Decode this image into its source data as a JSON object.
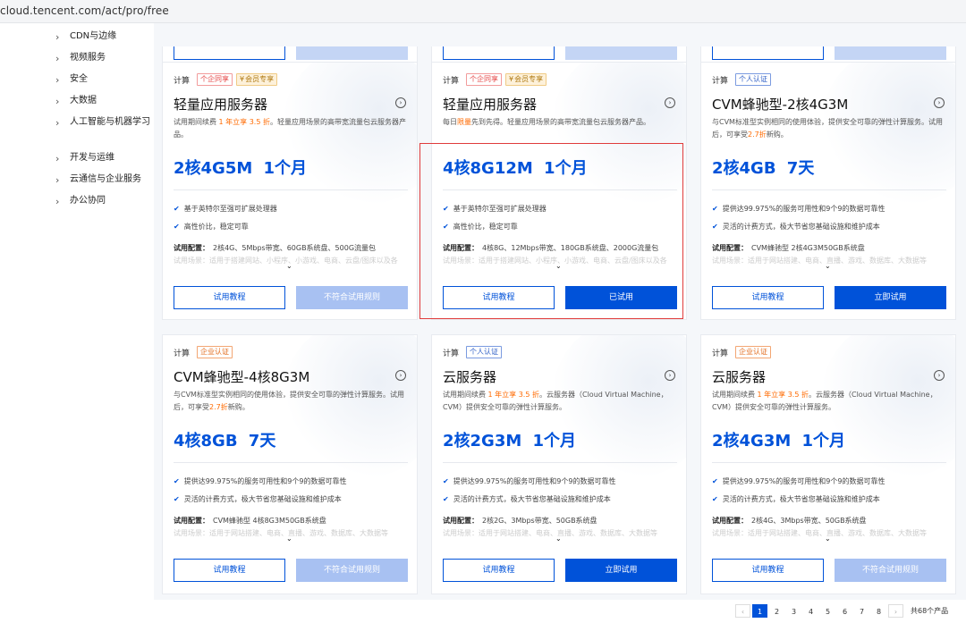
{
  "url": "cloud.tencent.com/act/pro/free",
  "sidebar": {
    "items": [
      {
        "label": "CDN与边缘"
      },
      {
        "label": "视频服务"
      },
      {
        "label": "安全"
      },
      {
        "label": "大数据"
      },
      {
        "label": "人工智能与机器学习"
      },
      {
        "label": "开发与运维"
      },
      {
        "label": "云通信与企业服务"
      },
      {
        "label": "办公协同"
      }
    ]
  },
  "cards": [
    {
      "category": "计算",
      "tags": [
        {
          "text": "个企同享",
          "style": "red"
        },
        {
          "text": "会员专享",
          "style": "gold",
          "icon": "vip-icon"
        }
      ],
      "title": "轻量应用服务器",
      "desc_parts": [
        "试用期间续费 ",
        "1 年立享 3.5 折",
        "。轻量应用场景的高带宽流量包云服务器产品。"
      ],
      "spec": "2核4G5M  1个月",
      "features": [
        "基于英特尔至强可扩展处理器",
        "高性价比，稳定可靠"
      ],
      "config_label": "试用配置：",
      "config": "2核4G、5Mbps带宽、60GB系统盘、500G流量包",
      "scene": "试用场景：适用于搭建网站、小程序、小游戏、电商、云盘/图床以及各",
      "btn1": "试用教程",
      "btn2": "不符合试用规则",
      "btn2_style": "disabled"
    },
    {
      "category": "计算",
      "tags": [
        {
          "text": "个企同享",
          "style": "red"
        },
        {
          "text": "会员专享",
          "style": "gold",
          "icon": "vip-icon"
        }
      ],
      "title": "轻量应用服务器",
      "desc_parts": [
        "每日",
        "限量",
        "先到先得。轻量应用场景的高带宽流量包云服务器产品。"
      ],
      "spec": "4核8G12M  1个月",
      "features": [
        "基于英特尔至强可扩展处理器",
        "高性价比，稳定可靠"
      ],
      "config_label": "试用配置：",
      "config": "4核8G、12Mbps带宽、180GB系统盘、2000G流量包",
      "scene": "试用场景：适用于搭建网站、小程序、小游戏、电商、云盘/图床以及各",
      "btn1": "试用教程",
      "btn2": "已试用",
      "btn2_style": "primary"
    },
    {
      "category": "计算",
      "tags": [
        {
          "text": "个人认证",
          "style": "blue"
        }
      ],
      "title": "CVM蜂驰型-2核4G3M",
      "desc_parts": [
        "与CVM标准型实例相同的使用体验，提供安全可靠的弹性计算服务。试用后，可享受",
        "2.7折",
        "新购。"
      ],
      "spec": "2核4GB  7天",
      "features": [
        "提供达99.975%的服务可用性和9个9的数据可靠性",
        "灵活的计费方式，极大节省您基础设施和维护成本"
      ],
      "config_label": "试用配置：",
      "config": "CVM蜂驰型 2核4G3M50GB系统盘",
      "scene": "试用场景：适用于网站搭建、电商、直播、游戏、数据库、大数据等",
      "btn1": "试用教程",
      "btn2": "立即试用",
      "btn2_style": "primary"
    },
    {
      "category": "计算",
      "tags": [
        {
          "text": "企业认证",
          "style": "orange"
        }
      ],
      "title": "CVM蜂驰型-4核8G3M",
      "desc_parts": [
        "与CVM标准型实例相同的使用体验，提供安全可靠的弹性计算服务。试用后，可享受",
        "2.7折",
        "新购。"
      ],
      "spec": "4核8GB  7天",
      "features": [
        "提供达99.975%的服务可用性和9个9的数据可靠性",
        "灵活的计费方式，极大节省您基础设施和维护成本"
      ],
      "config_label": "试用配置：",
      "config": "CVM蜂驰型 4核8G3M50GB系统盘",
      "scene": "试用场景：适用于网站搭建、电商、直播、游戏、数据库、大数据等",
      "btn1": "试用教程",
      "btn2": "不符合试用规则",
      "btn2_style": "disabled"
    },
    {
      "category": "计算",
      "tags": [
        {
          "text": "个人认证",
          "style": "blue"
        }
      ],
      "title": "云服务器",
      "desc_parts": [
        "试用期间续费 ",
        "1 年立享 3.5 折",
        "。云服务器（Cloud Virtual Machine，CVM）提供安全可靠的弹性计算服务。"
      ],
      "spec": "2核2G3M  1个月",
      "features": [
        "提供达99.975%的服务可用性和9个9的数据可靠性",
        "灵活的计费方式，极大节省您基础设施和维护成本"
      ],
      "config_label": "试用配置：",
      "config": "2核2G、3Mbps带宽、50GB系统盘",
      "scene": "试用场景：适用于网站搭建、电商、直播、游戏、数据库、大数据等",
      "btn1": "试用教程",
      "btn2": "立即试用",
      "btn2_style": "primary"
    },
    {
      "category": "计算",
      "tags": [
        {
          "text": "企业认证",
          "style": "orange"
        }
      ],
      "title": "云服务器",
      "desc_parts": [
        "试用期间续费 ",
        "1 年立享 3.5 折",
        "。云服务器（Cloud Virtual Machine，CVM）提供安全可靠的弹性计算服务。"
      ],
      "spec": "2核4G3M  1个月",
      "features": [
        "提供达99.975%的服务可用性和9个9的数据可靠性",
        "灵活的计费方式，极大节省您基础设施和维护成本"
      ],
      "config_label": "试用配置：",
      "config": "2核4G、3Mbps带宽、50GB系统盘",
      "scene": "试用场景：适用于网站搭建、电商、直播、游戏、数据库、大数据等",
      "btn1": "试用教程",
      "btn2": "不符合试用规则",
      "btn2_style": "disabled"
    }
  ],
  "pagination": {
    "prev": "‹",
    "pages": [
      "1",
      "2",
      "3",
      "4",
      "5",
      "6",
      "7",
      "8"
    ],
    "current": "1",
    "next": "›",
    "total": "共68个产品"
  },
  "colors": {
    "accent": "#0052d9",
    "highlight": "#ff6a00",
    "selection_box": "#e03b3b"
  }
}
